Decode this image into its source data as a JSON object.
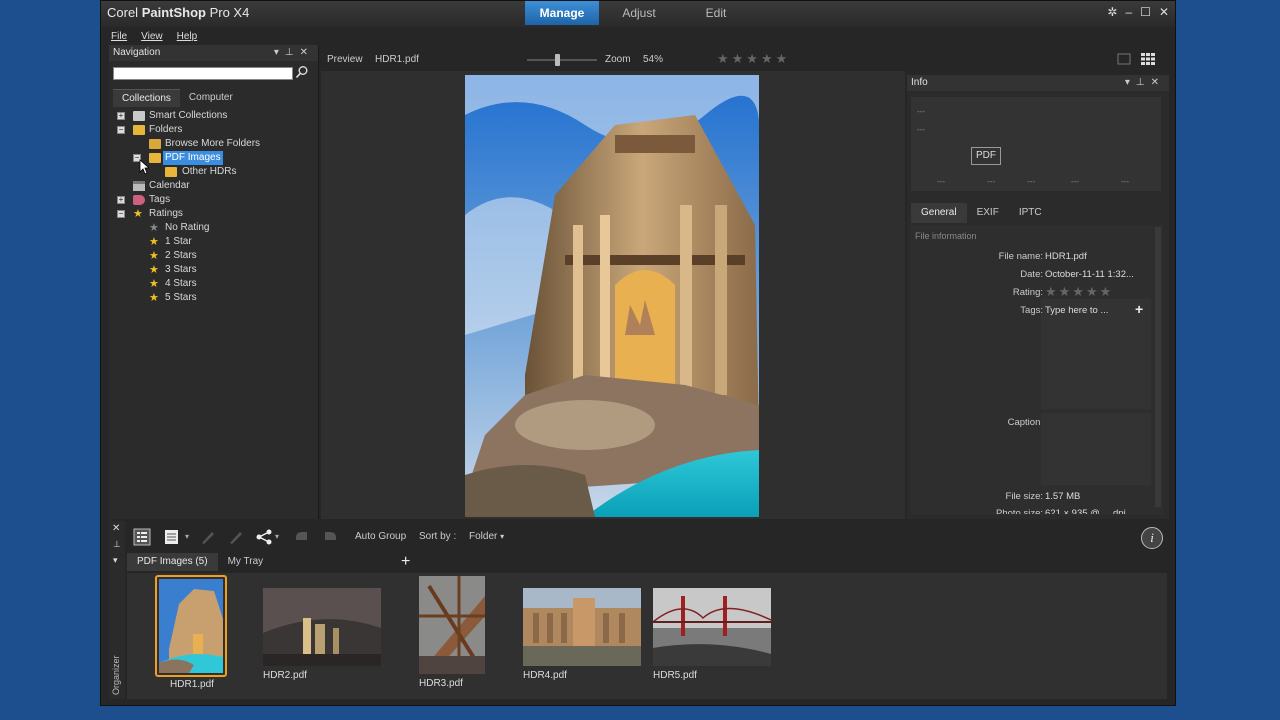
{
  "app": {
    "title_prefix": "Corel ",
    "title_bold": "PaintShop",
    "title_suffix": " Pro X4"
  },
  "modes": [
    {
      "label": "Manage",
      "active": true
    },
    {
      "label": "Adjust"
    },
    {
      "label": "Edit"
    }
  ],
  "menu": [
    "File",
    "View",
    "Help"
  ],
  "navigation": {
    "title": "Navigation",
    "tabs": [
      "Collections",
      "Computer"
    ],
    "tree": [
      {
        "label": "Smart Collections",
        "level": 0,
        "expander": "+",
        "icon": "smart-collection-icon"
      },
      {
        "label": "Folders",
        "level": 0,
        "expander": "−",
        "icon": "folder-icon"
      },
      {
        "label": "Browse More Folders",
        "level": 1,
        "icon": "browse-folder-icon"
      },
      {
        "label": "PDF Images",
        "level": 1,
        "expander": "−",
        "icon": "folder-icon",
        "selected": true
      },
      {
        "label": "Other HDRs",
        "level": 2,
        "icon": "folder-icon"
      },
      {
        "label": "Calendar",
        "level": 0,
        "icon": "calendar-icon"
      },
      {
        "label": "Tags",
        "level": 0,
        "expander": "+",
        "icon": "tag-icon"
      },
      {
        "label": "Ratings",
        "level": 0,
        "expander": "−",
        "icon": "star-icon"
      },
      {
        "label": "No Rating",
        "level": 1,
        "icon": "star-gray-icon"
      },
      {
        "label": "1 Star",
        "level": 1,
        "icon": "star-icon"
      },
      {
        "label": "2 Stars",
        "level": 1,
        "icon": "star-icon"
      },
      {
        "label": "3 Stars",
        "level": 1,
        "icon": "star-icon"
      },
      {
        "label": "4 Stars",
        "level": 1,
        "icon": "star-icon"
      },
      {
        "label": "5 Stars",
        "level": 1,
        "icon": "star-icon"
      }
    ]
  },
  "preview": {
    "label": "Preview",
    "filename": "HDR1.pdf",
    "zoom_label": "Zoom",
    "zoom_value": "54%",
    "rating": 0,
    "max_rating": 5
  },
  "info": {
    "title": "Info",
    "preview_dashes": [
      "---",
      "---"
    ],
    "bottom_dashes": [
      "---",
      "---",
      "---",
      "---",
      "---"
    ],
    "badge": "PDF",
    "tabs": [
      "General",
      "EXIF",
      "IPTC"
    ],
    "section": "File information",
    "fields": {
      "file_name_label": "File name:",
      "file_name": "HDR1.pdf",
      "date_label": "Date:",
      "date": "October-11-11 1:32...",
      "rating_label": "Rating:",
      "tags_label": "Tags:",
      "tags_placeholder": "Type here to ...",
      "caption_label": "Caption:",
      "file_size_label": "File size:",
      "file_size": "1.57 MB",
      "photo_size_label": "Photo size:",
      "photo_size": "621 × 935 @ ... dpi"
    }
  },
  "organizer": {
    "side_label": "Organizer",
    "auto_group": "Auto Group",
    "sort_by_label": "Sort by :",
    "sort_by_value": "Folder",
    "tabs": [
      "PDF Images (5)",
      "My Tray"
    ],
    "thumbnails": [
      "HDR1.pdf",
      "HDR2.pdf",
      "HDR3.pdf",
      "HDR4.pdf",
      "HDR5.pdf"
    ]
  },
  "colors": {
    "accent": "#3b8de0",
    "selection_frame": "#f0a020",
    "desktop": "#1d4f8e"
  }
}
